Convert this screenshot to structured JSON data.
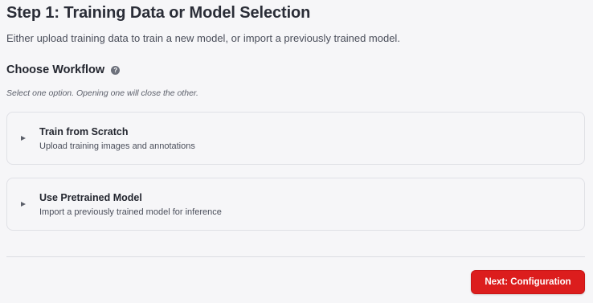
{
  "header": {
    "title": "Step 1: Training Data or Model Selection",
    "subtitle": "Either upload training data to train a new model, or import a previously trained model."
  },
  "workflow": {
    "heading": "Choose Workflow",
    "help_icon": "question-circle-icon",
    "hint": "Select one option. Opening one will close the other.",
    "options": [
      {
        "title": "Train from Scratch",
        "description": "Upload training images and annotations",
        "expanded": false
      },
      {
        "title": "Use Pretrained Model",
        "description": "Import a previously trained model for inference",
        "expanded": false
      }
    ]
  },
  "footer": {
    "next_label": "Next: Configuration"
  },
  "colors": {
    "accent": "#dc1d1d",
    "background": "#f6f6f8",
    "border": "#e0e1e6"
  }
}
